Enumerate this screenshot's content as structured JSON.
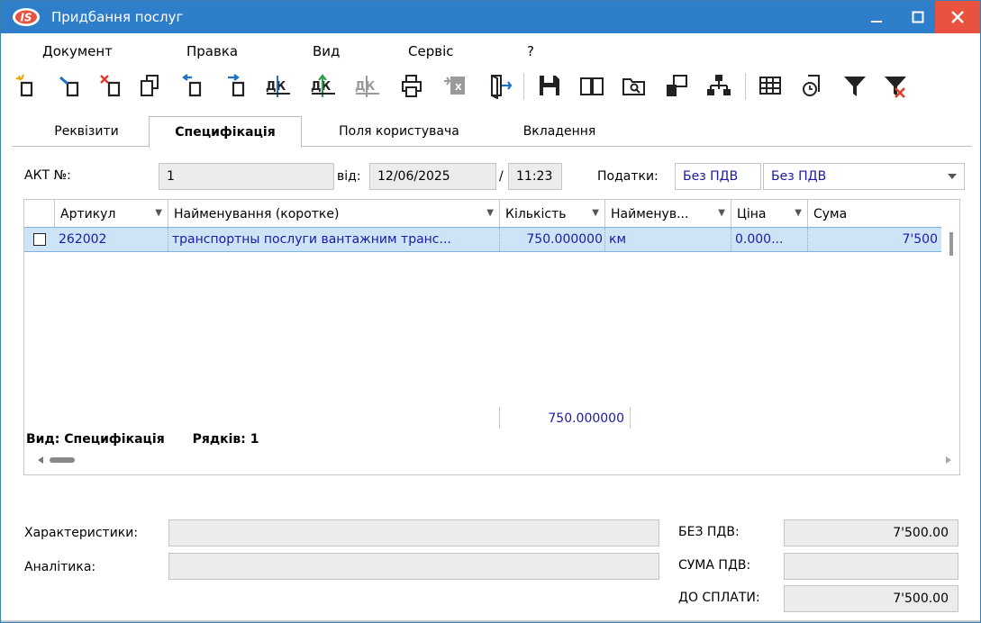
{
  "window": {
    "title": "Придбання послуг",
    "logo_text": "IS",
    "controls": [
      "minimize-icon",
      "maximize-icon",
      "close-icon"
    ]
  },
  "menu": {
    "document": "Документ",
    "edit": "Правка",
    "view": "Вид",
    "service": "Сервіс",
    "help": "?"
  },
  "toolbar": {
    "icons": [
      "new-icon",
      "edit-icon",
      "delete-icon",
      "copy-icon",
      "move-up-icon",
      "move-down-icon",
      "debit-credit-icon",
      "debit-credit-green-icon",
      "debit-credit-disabled-icon",
      "print-icon",
      "export-disabled-icon",
      "exit-icon",
      "save-icon",
      "book-icon",
      "folder-search-icon",
      "link-icon",
      "hierarchy-icon",
      "table-icon",
      "history-icon",
      "filter-icon",
      "filter-clear-icon"
    ],
    "accent_red": "#e03c2c",
    "accent_blue": "#1f6fc4",
    "accent_green": "#2e9b4d"
  },
  "tabs": {
    "requisites": "Реквізити",
    "specification": "Специфікація",
    "user_fields": "Поля користувача",
    "attachments": "Вкладення",
    "active": "Специфікація"
  },
  "header": {
    "act_label": "АКТ №:",
    "act_value": "1",
    "from_label": "від:",
    "date_value": "12/06/2025",
    "slash": "/",
    "time_value": "11:23",
    "taxes_label": "Податки:",
    "tax_code": "Без ПДВ",
    "tax_name": "Без ПДВ"
  },
  "grid": {
    "columns": [
      "Артикул",
      "Найменування (коротке)",
      "Кількість",
      "Найменув...",
      "Ціна",
      "Сума"
    ],
    "rows": [
      {
        "article": "262002",
        "name": "транспортны послуги вантажним транс...",
        "quantity": "750.000000",
        "unit": "км",
        "price": "0.000...",
        "sum": "7'500"
      }
    ],
    "total_quantity": "750.000000",
    "footer_view": "Вид: Специфікація",
    "footer_rows": "Рядків: 1"
  },
  "bottom": {
    "characteristics_label": "Характеристики:",
    "analytics_label": "Аналітика:",
    "no_vat_label": "БЕЗ ПДВ:",
    "no_vat_value": "7'500.00",
    "vat_sum_label": "СУМА ПДВ:",
    "vat_sum_value": "",
    "to_pay_label": "ДО СПЛАТИ:",
    "to_pay_value": "7'500.00"
  },
  "colors": {
    "titlebar": "#2f7ec9",
    "close_button": "#e8523f",
    "selected_row": "#cde4f7",
    "data_text": "#1a1aa6"
  }
}
